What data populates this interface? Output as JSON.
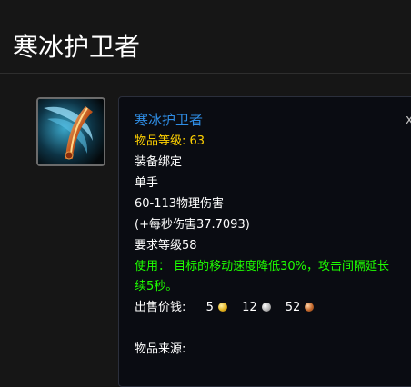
{
  "page": {
    "title": "寒冰护卫者"
  },
  "tooltip": {
    "name": "寒冰护卫者",
    "item_level": "物品等级: 63",
    "binding": "装备绑定",
    "slot": "单手",
    "damage": "60-113物理伤害",
    "dps": "(+每秒伤害37.7093)",
    "required_level": "要求等级58",
    "use_line1": "使用：  目标的移动速度降低30%，攻击间隔延长",
    "use_line2": "续5秒。",
    "sell_label": "出售价钱:",
    "sell_gold": "5",
    "sell_silver": "12",
    "sell_copper": "52",
    "source_label": "物品来源:",
    "close_glyph": "x"
  },
  "colors": {
    "item_name": "#2f8de4",
    "item_level": "#ffd100",
    "use_effect": "#1eff00"
  },
  "icons": {
    "item": "ice-blade-weapon-icon",
    "gold": "gold-coin-icon",
    "silver": "silver-coin-icon",
    "copper": "copper-coin-icon"
  }
}
